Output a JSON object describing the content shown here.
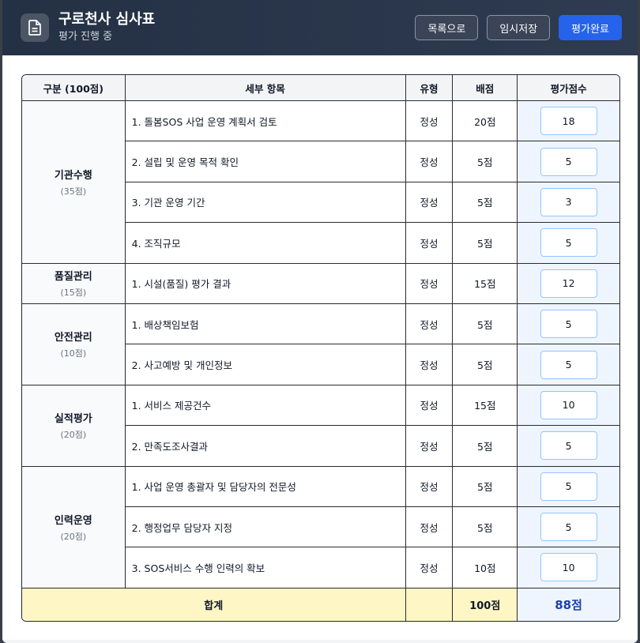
{
  "header": {
    "title": "구로천사 심사표",
    "subtitle": "평가 진행 중",
    "buttons": {
      "list": "목록으로",
      "save": "임시저장",
      "complete": "평가완료"
    }
  },
  "table": {
    "headers": {
      "category": "구분 (100점)",
      "item": "세부 항목",
      "type": "유형",
      "points": "배점",
      "score": "평가점수"
    },
    "groups": [
      {
        "name": "기관수행",
        "points": "(35점)",
        "rows": [
          {
            "item": "1. 돌봄SOS 사업 운영 계획서 검토",
            "type": "정성",
            "points": "20점",
            "score": "18"
          },
          {
            "item": "2. 설립 및 운영 목적 확인",
            "type": "정성",
            "points": "5점",
            "score": "5"
          },
          {
            "item": "3. 기관 운영 기간",
            "type": "정성",
            "points": "5점",
            "score": "3"
          },
          {
            "item": "4. 조직규모",
            "type": "정성",
            "points": "5점",
            "score": "5"
          }
        ]
      },
      {
        "name": "품질관리",
        "points": "(15점)",
        "rows": [
          {
            "item": "1. 시설(품질) 평가 결과",
            "type": "정성",
            "points": "15점",
            "score": "12"
          }
        ]
      },
      {
        "name": "안전관리",
        "points": "(10점)",
        "rows": [
          {
            "item": "1. 배상책임보험",
            "type": "정성",
            "points": "5점",
            "score": "5"
          },
          {
            "item": "2. 사고예방 및 개인정보",
            "type": "정성",
            "points": "5점",
            "score": "5"
          }
        ]
      },
      {
        "name": "실적평가",
        "points": "(20점)",
        "rows": [
          {
            "item": "1. 서비스 제공건수",
            "type": "정성",
            "points": "15점",
            "score": "10"
          },
          {
            "item": "2. 만족도조사결과",
            "type": "정성",
            "points": "5점",
            "score": "5"
          }
        ]
      },
      {
        "name": "인력운영",
        "points": "(20점)",
        "rows": [
          {
            "item": "1. 사업 운영 총괄자 및 담당자의 전문성",
            "type": "정성",
            "points": "5점",
            "score": "5"
          },
          {
            "item": "2. 행정업무 담당자 지정",
            "type": "정성",
            "points": "5점",
            "score": "5"
          },
          {
            "item": "3. SOS서비스 수행 인력의 확보",
            "type": "정성",
            "points": "10점",
            "score": "10"
          }
        ]
      }
    ],
    "total": {
      "label": "합계",
      "type": "",
      "points": "100점",
      "score": "88점"
    }
  },
  "colors": {
    "header_bg": "#243044",
    "primary": "#2563eb",
    "total_row": "#fef6c4",
    "score_col": "#eef5ff",
    "total_score": "#1e40af"
  },
  "icons": {
    "header": "document-icon"
  }
}
